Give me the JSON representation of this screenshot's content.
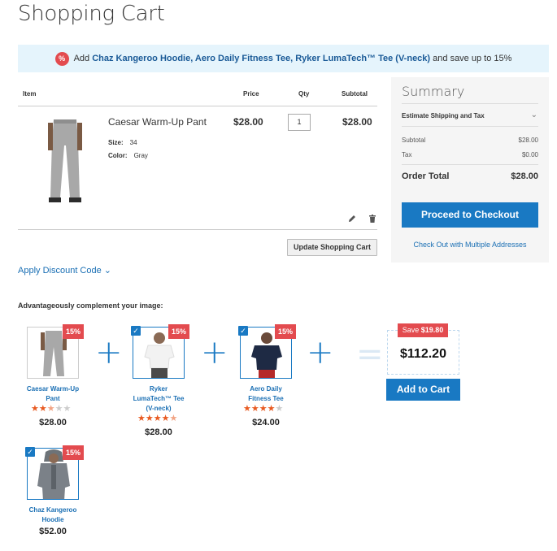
{
  "page": {
    "title": "Shopping Cart"
  },
  "promo": {
    "icon": "percent-icon",
    "prefix": "Add",
    "products": "Chaz Kangeroo Hoodie, Aero Daily Fitness Tee, Ryker LumaTech™ Tee (V-neck)",
    "suffix": "and save up to 15%"
  },
  "cart": {
    "headers": {
      "item": "Item",
      "price": "Price",
      "qty": "Qty",
      "subtotal": "Subtotal"
    },
    "item": {
      "name": "Caesar Warm-Up Pant",
      "size_label": "Size:",
      "size_value": "34",
      "color_label": "Color:",
      "color_value": "Gray",
      "price": "$28.00",
      "qty": "1",
      "subtotal": "$28.00"
    },
    "update_label": "Update Shopping Cart",
    "discount_label": "Apply Discount Code"
  },
  "summary": {
    "title": "Summary",
    "estimate_label": "Estimate Shipping and Tax",
    "subtotal_label": "Subtotal",
    "subtotal_value": "$28.00",
    "tax_label": "Tax",
    "tax_value": "$0.00",
    "total_label": "Order Total",
    "total_value": "$28.00",
    "checkout_label": "Proceed to Checkout",
    "multi_label": "Check Out with Multiple Addresses"
  },
  "fbt": {
    "title": "Advantageously complement your image:",
    "items": [
      {
        "name_line1": "Caesar Warm-Up",
        "name_line2": "Pant",
        "name_line3": "",
        "price": "$28.00",
        "badge": "15%",
        "rating": 2.5,
        "selected": false
      },
      {
        "name_line1": "Ryker",
        "name_line2": "LumaTech™ Tee",
        "name_line3": "(V-neck)",
        "price": "$28.00",
        "badge": "15%",
        "rating": 4.5,
        "selected": true
      },
      {
        "name_line1": "Aero Daily",
        "name_line2": "Fitness Tee",
        "name_line3": "",
        "price": "$24.00",
        "badge": "15%",
        "rating": 4,
        "selected": true
      },
      {
        "name_line1": "Chaz Kangeroo",
        "name_line2": "Hoodie",
        "name_line3": "",
        "price": "$52.00",
        "badge": "15%",
        "rating": 0,
        "selected": true
      }
    ],
    "save_prefix": "Save",
    "save_amount": "$19.80",
    "bundle_price": "$112.20",
    "add_label": "Add to Cart"
  },
  "colors": {
    "accent": "#1979c3",
    "badge": "#e34b4f",
    "star": "#e85a21",
    "promo_bg": "#e5f4fc"
  }
}
